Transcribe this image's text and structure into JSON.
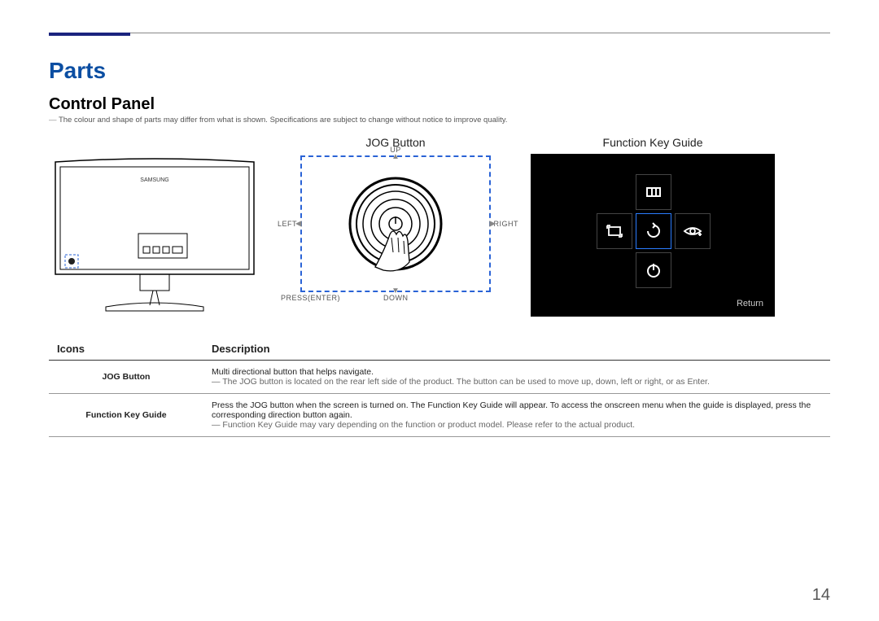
{
  "header": {
    "title": "Parts",
    "subtitle": "Control Panel"
  },
  "disclaimer": "The colour and shape of parts may differ from what is shown. Specifications are subject to change without notice to improve quality.",
  "monitor": {
    "brand": "SAMSUNG"
  },
  "jog": {
    "label": "JOG Button",
    "up": "UP",
    "down": "DOWN",
    "left": "LEFT",
    "right": "RIGHT",
    "enter": "PRESS(ENTER)"
  },
  "fkg": {
    "label": "Function Key Guide",
    "return": "Return",
    "icons": {
      "top": "menu-grid-icon",
      "left": "picture-size-icon",
      "center": "rotate-icon",
      "right": "eye-saver-icon",
      "bottom": "power-icon"
    }
  },
  "table": {
    "headers": {
      "icons": "Icons",
      "desc": "Description"
    },
    "rows": [
      {
        "icon": "JOG Button",
        "desc": "Multi directional button that helps navigate.",
        "note": "The JOG button is located on the rear left side of the product. The button can be used to move up, down, left or right, or as Enter."
      },
      {
        "icon": "Function Key Guide",
        "desc": "Press the JOG button when the screen is turned on. The Function Key Guide will appear. To access the onscreen menu when the guide is displayed, press the corresponding direction button again.",
        "note": "Function Key Guide may vary depending on the function or product model. Please refer to the actual product."
      }
    ]
  },
  "page_number": "14"
}
